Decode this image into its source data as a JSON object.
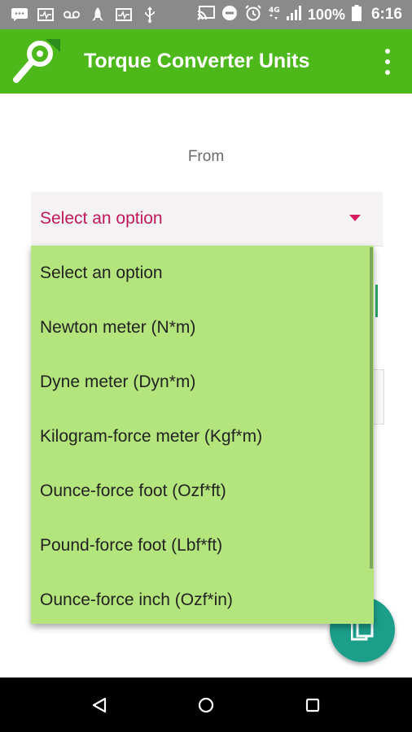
{
  "status_bar": {
    "battery_percent": "100%",
    "time": "6:16",
    "left_icons": [
      "chat-icon",
      "signal-monitor-icon",
      "voicemail-icon",
      "rocket-icon",
      "signal-monitor-icon",
      "usb-icon"
    ],
    "right_icons": [
      "cast-icon",
      "do-not-disturb-icon",
      "alarm-icon",
      "4g-icon",
      "cell-signal-icon",
      "battery-icon"
    ]
  },
  "app_bar": {
    "title": "Torque Converter Units",
    "logo_icon": "wrench-icon",
    "menu_icon": "more-vert-icon",
    "color": "#4cb81a"
  },
  "form": {
    "from_label": "From",
    "spinner_selected": "Select an option"
  },
  "dropdown": {
    "options": [
      "Select an option",
      "Newton meter (N*m)",
      "Dyne meter (Dyn*m)",
      "Kilogram-force meter (Kgf*m)",
      "Ounce-force foot (Ozf*ft)",
      "Pound-force foot (Lbf*ft)",
      "Ounce-force inch (Ozf*in)"
    ],
    "background_color": "#b3e57c"
  },
  "fab": {
    "icon": "copy-icon",
    "color": "#1b9e8a"
  },
  "nav_bar": {
    "buttons": [
      "back-icon",
      "home-icon",
      "recents-icon"
    ]
  }
}
